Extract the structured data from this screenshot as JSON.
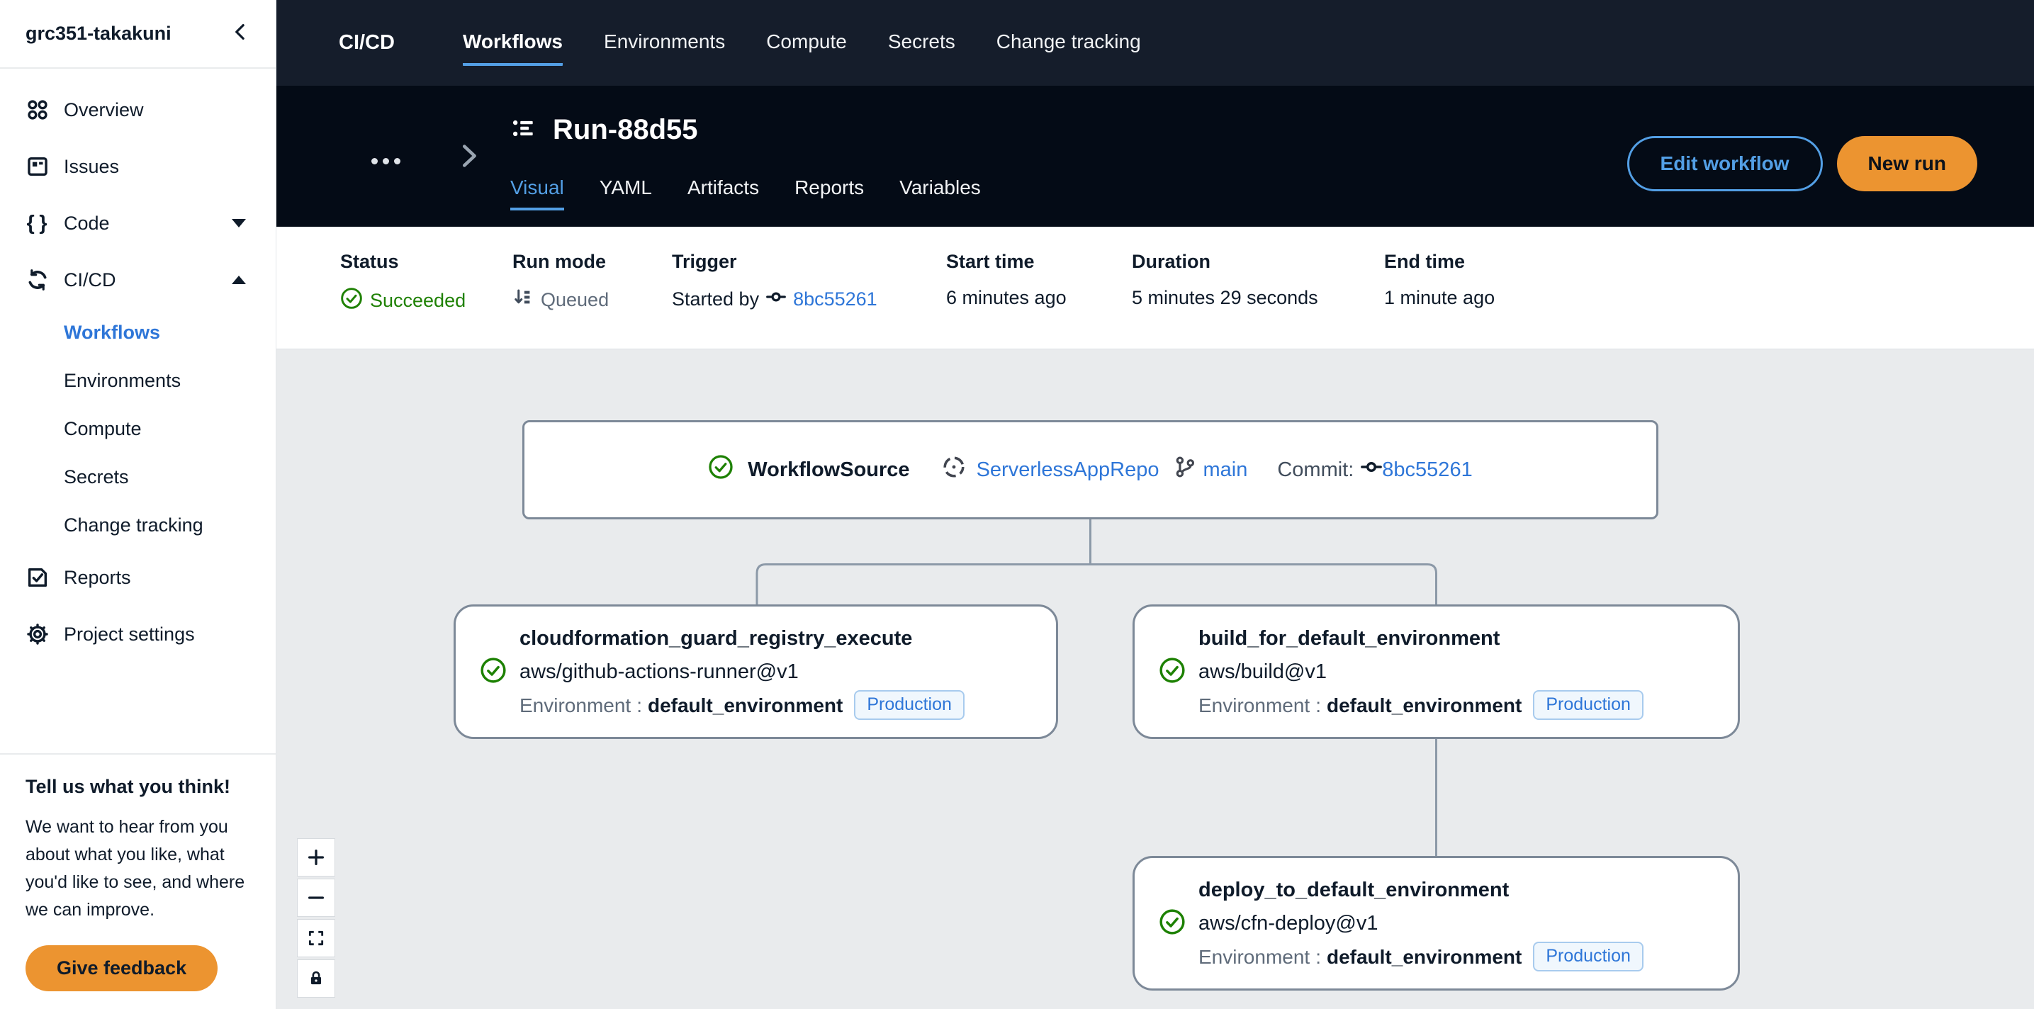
{
  "sidebar": {
    "project_name": "grc351-takakuni",
    "items": [
      {
        "label": "Overview"
      },
      {
        "label": "Issues"
      },
      {
        "label": "Code"
      },
      {
        "label": "CI/CD"
      },
      {
        "label": "Workflows",
        "active": true
      },
      {
        "label": "Environments"
      },
      {
        "label": "Compute"
      },
      {
        "label": "Secrets"
      },
      {
        "label": "Change tracking"
      },
      {
        "label": "Reports"
      },
      {
        "label": "Project settings"
      }
    ],
    "feedback": {
      "title": "Tell us what you think!",
      "body": "We want to hear from you about what you like, what you'd like to see, and where we can improve.",
      "button": "Give feedback"
    }
  },
  "topnav": {
    "section": "CI/CD",
    "tabs": [
      {
        "label": "Workflows",
        "active": true
      },
      {
        "label": "Environments"
      },
      {
        "label": "Compute"
      },
      {
        "label": "Secrets"
      },
      {
        "label": "Change tracking"
      }
    ]
  },
  "run_header": {
    "title": "Run-88d55",
    "tabs": [
      {
        "label": "Visual",
        "active": true
      },
      {
        "label": "YAML"
      },
      {
        "label": "Artifacts"
      },
      {
        "label": "Reports"
      },
      {
        "label": "Variables"
      }
    ],
    "edit_button": "Edit workflow",
    "new_run_button": "New run"
  },
  "status_bar": {
    "columns": [
      {
        "label": "Status",
        "value": "Succeeded"
      },
      {
        "label": "Run mode",
        "value": "Queued"
      },
      {
        "label": "Trigger",
        "prefix": "Started by",
        "link": "8bc55261"
      },
      {
        "label": "Start time",
        "value": "6 minutes ago"
      },
      {
        "label": "Duration",
        "value": "5 minutes 29 seconds"
      },
      {
        "label": "End time",
        "value": "1 minute ago"
      }
    ]
  },
  "workflow": {
    "source": {
      "name": "WorkflowSource",
      "repo": "ServerlessAppRepo",
      "branch": "main",
      "commit_label": "Commit:",
      "commit": "8bc55261"
    },
    "nodes": [
      {
        "title": "cloudformation_guard_registry_execute",
        "action": "aws/github-actions-runner@v1",
        "env_label": "Environment",
        "env_sep": ":",
        "env_name": "default_environment",
        "badge": "Production"
      },
      {
        "title": "build_for_default_environment",
        "action": "aws/build@v1",
        "env_label": "Environment",
        "env_sep": ":",
        "env_name": "default_environment",
        "badge": "Production"
      },
      {
        "title": "deploy_to_default_environment",
        "action": "aws/cfn-deploy@v1",
        "env_label": "Environment",
        "env_sep": ":",
        "env_name": "default_environment",
        "badge": "Production"
      }
    ]
  },
  "colors": {
    "link_blue": "#2e76d8",
    "tab_underline_blue": "#539fe5",
    "success_green": "#1f8104",
    "brand_orange": "#ec9430",
    "topnav_bg": "#151d2b",
    "runheader_bg": "#040b16",
    "canvas_bg": "#e9ebed",
    "node_border": "#7d8998",
    "connector_gray": "#8c99a8"
  }
}
